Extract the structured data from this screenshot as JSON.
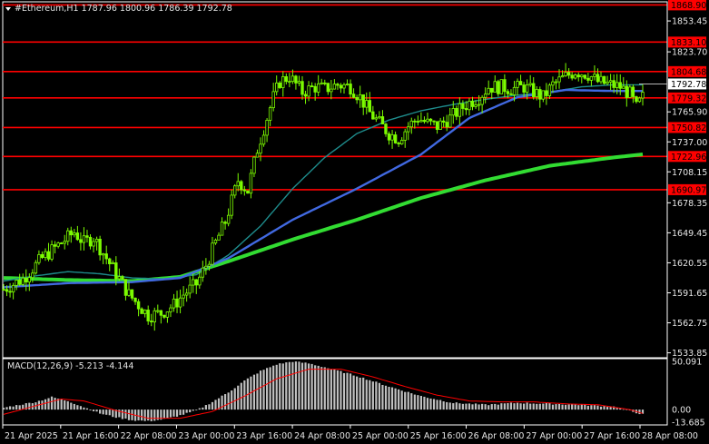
{
  "header": {
    "symbol_line": "#Ethereum,H1  1787.96 1800.96 1786.39 1792.78"
  },
  "macd_header": {
    "label": "MACD(12,26,9) -5.213 -4.144"
  },
  "colors": {
    "background": "#000000",
    "candle": "#7cfc00",
    "ma_fast": "#1e8c8c",
    "ma_mid": "#4169e1",
    "ma_slow": "#32dc32",
    "level_line": "#ff0000",
    "level_box": "#ff0000",
    "macd_hist": "#c0c0c0",
    "macd_signal": "#ff0000",
    "axis": "#ffffff"
  },
  "chart_data": [
    {
      "type": "candlestick",
      "title": "#Ethereum,H1",
      "ohlc_last": {
        "open": 1787.96,
        "high": 1800.96,
        "low": 1786.39,
        "close": 1792.78
      },
      "current_price": 1792.78,
      "ylim": [
        1530,
        1871
      ],
      "y_ticks": [
        1853.45,
        1823.7,
        1765.9,
        1737.0,
        1708.15,
        1678.35,
        1649.45,
        1620.55,
        1591.65,
        1562.75,
        1533.85
      ],
      "x_ticks": [
        "21 Apr 2025",
        "21 Apr 16:00",
        "22 Apr 08:00",
        "23 Apr 00:00",
        "23 Apr 16:00",
        "24 Apr 08:00",
        "25 Apr 00:00",
        "25 Apr 16:00",
        "26 Apr 08:00",
        "27 Apr 00:00",
        "27 Apr 16:00",
        "28 Apr 08:00"
      ],
      "levels": [
        {
          "label": "1868.90",
          "value": 1868.9
        },
        {
          "label": "1833.10",
          "value": 1833.1
        },
        {
          "label": "1804.68",
          "value": 1804.68
        },
        {
          "label": "1779.32",
          "value": 1779.32
        },
        {
          "label": "1750.82",
          "value": 1750.82
        },
        {
          "label": "1722.96",
          "value": 1722.96
        },
        {
          "label": "1690.97",
          "value": 1690.97
        }
      ],
      "close_path": [
        [
          0,
          1595
        ],
        [
          6,
          1605
        ],
        [
          12,
          1625
        ],
        [
          18,
          1640
        ],
        [
          22,
          1650
        ],
        [
          25,
          1640
        ],
        [
          28,
          1645
        ],
        [
          32,
          1625
        ],
        [
          36,
          1605
        ],
        [
          39,
          1590
        ],
        [
          42,
          1580
        ],
        [
          45,
          1570
        ],
        [
          49,
          1572
        ],
        [
          53,
          1580
        ],
        [
          56,
          1590
        ],
        [
          60,
          1600
        ],
        [
          63,
          1618
        ],
        [
          66,
          1640
        ],
        [
          69,
          1660
        ],
        [
          71,
          1680
        ],
        [
          73,
          1700
        ],
        [
          76,
          1690
        ],
        [
          79,
          1730
        ],
        [
          82,
          1760
        ],
        [
          84,
          1780
        ],
        [
          86,
          1795
        ],
        [
          89,
          1800
        ],
        [
          93,
          1785
        ],
        [
          97,
          1790
        ],
        [
          100,
          1788
        ],
        [
          104,
          1792
        ],
        [
          108,
          1790
        ],
        [
          111,
          1780
        ],
        [
          114,
          1765
        ],
        [
          117,
          1755
        ],
        [
          120,
          1745
        ],
        [
          123,
          1740
        ],
        [
          126,
          1752
        ],
        [
          129,
          1760
        ],
        [
          132,
          1755
        ],
        [
          135,
          1752
        ],
        [
          139,
          1760
        ],
        [
          142,
          1768
        ],
        [
          145,
          1775
        ],
        [
          148,
          1780
        ],
        [
          151,
          1790
        ],
        [
          155,
          1790
        ],
        [
          158,
          1788
        ],
        [
          162,
          1790
        ],
        [
          165,
          1785
        ],
        [
          168,
          1780
        ],
        [
          171,
          1792
        ],
        [
          175,
          1800
        ],
        [
          178,
          1805
        ],
        [
          182,
          1802
        ],
        [
          185,
          1795
        ],
        [
          189,
          1792
        ],
        [
          192,
          1790
        ],
        [
          195,
          1783
        ],
        [
          197,
          1770
        ],
        [
          199,
          1780
        ]
      ],
      "ma_fast": [
        [
          0,
          1603
        ],
        [
          10,
          1608
        ],
        [
          20,
          1612
        ],
        [
          30,
          1610
        ],
        [
          40,
          1606
        ],
        [
          50,
          1605
        ],
        [
          60,
          1609
        ],
        [
          70,
          1628
        ],
        [
          80,
          1656
        ],
        [
          90,
          1692
        ],
        [
          100,
          1722
        ],
        [
          110,
          1745
        ],
        [
          120,
          1758
        ],
        [
          130,
          1767
        ],
        [
          140,
          1773
        ],
        [
          150,
          1778
        ],
        [
          160,
          1782
        ],
        [
          170,
          1785
        ],
        [
          180,
          1790
        ],
        [
          190,
          1792
        ],
        [
          199,
          1792
        ]
      ],
      "ma_mid": [
        [
          0,
          1597
        ],
        [
          20,
          1601
        ],
        [
          40,
          1602
        ],
        [
          55,
          1606
        ],
        [
          70,
          1625
        ],
        [
          90,
          1662
        ],
        [
          110,
          1692
        ],
        [
          130,
          1725
        ],
        [
          145,
          1760
        ],
        [
          160,
          1780
        ],
        [
          175,
          1787
        ],
        [
          190,
          1786
        ],
        [
          199,
          1786
        ]
      ],
      "ma_slow": [
        [
          0,
          1606
        ],
        [
          20,
          1604
        ],
        [
          40,
          1603
        ],
        [
          55,
          1607
        ],
        [
          70,
          1622
        ],
        [
          90,
          1643
        ],
        [
          110,
          1662
        ],
        [
          130,
          1683
        ],
        [
          150,
          1700
        ],
        [
          170,
          1714
        ],
        [
          190,
          1722
        ],
        [
          199,
          1725
        ]
      ]
    },
    {
      "type": "bar",
      "title": "MACD(12,26,9)",
      "main_value": -5.213,
      "signal_value": -4.144,
      "ylim": [
        -15,
        52
      ],
      "y_ticks": [
        50.091,
        0.0,
        -13.685
      ],
      "histogram_path": [
        [
          0,
          2
        ],
        [
          10,
          8
        ],
        [
          15,
          13
        ],
        [
          20,
          9
        ],
        [
          30,
          -4
        ],
        [
          35,
          -8
        ],
        [
          40,
          -11
        ],
        [
          45,
          -12
        ],
        [
          50,
          -10
        ],
        [
          55,
          -6
        ],
        [
          60,
          -1
        ],
        [
          65,
          8
        ],
        [
          70,
          18
        ],
        [
          75,
          30
        ],
        [
          80,
          40
        ],
        [
          85,
          47
        ],
        [
          90,
          50
        ],
        [
          95,
          48
        ],
        [
          100,
          44
        ],
        [
          110,
          35
        ],
        [
          120,
          24
        ],
        [
          130,
          14
        ],
        [
          140,
          7
        ],
        [
          150,
          5
        ],
        [
          160,
          7
        ],
        [
          170,
          6
        ],
        [
          180,
          5
        ],
        [
          190,
          3
        ],
        [
          199,
          -5
        ]
      ],
      "signal_path": [
        [
          0,
          -5
        ],
        [
          10,
          4
        ],
        [
          18,
          11
        ],
        [
          25,
          9
        ],
        [
          35,
          -1
        ],
        [
          45,
          -9
        ],
        [
          55,
          -9
        ],
        [
          65,
          -2
        ],
        [
          75,
          14
        ],
        [
          85,
          32
        ],
        [
          95,
          42
        ],
        [
          105,
          42
        ],
        [
          115,
          34
        ],
        [
          125,
          24
        ],
        [
          135,
          15
        ],
        [
          145,
          9
        ],
        [
          155,
          8
        ],
        [
          165,
          8
        ],
        [
          175,
          6
        ],
        [
          185,
          5
        ],
        [
          195,
          0
        ],
        [
          199,
          -4
        ]
      ]
    }
  ]
}
